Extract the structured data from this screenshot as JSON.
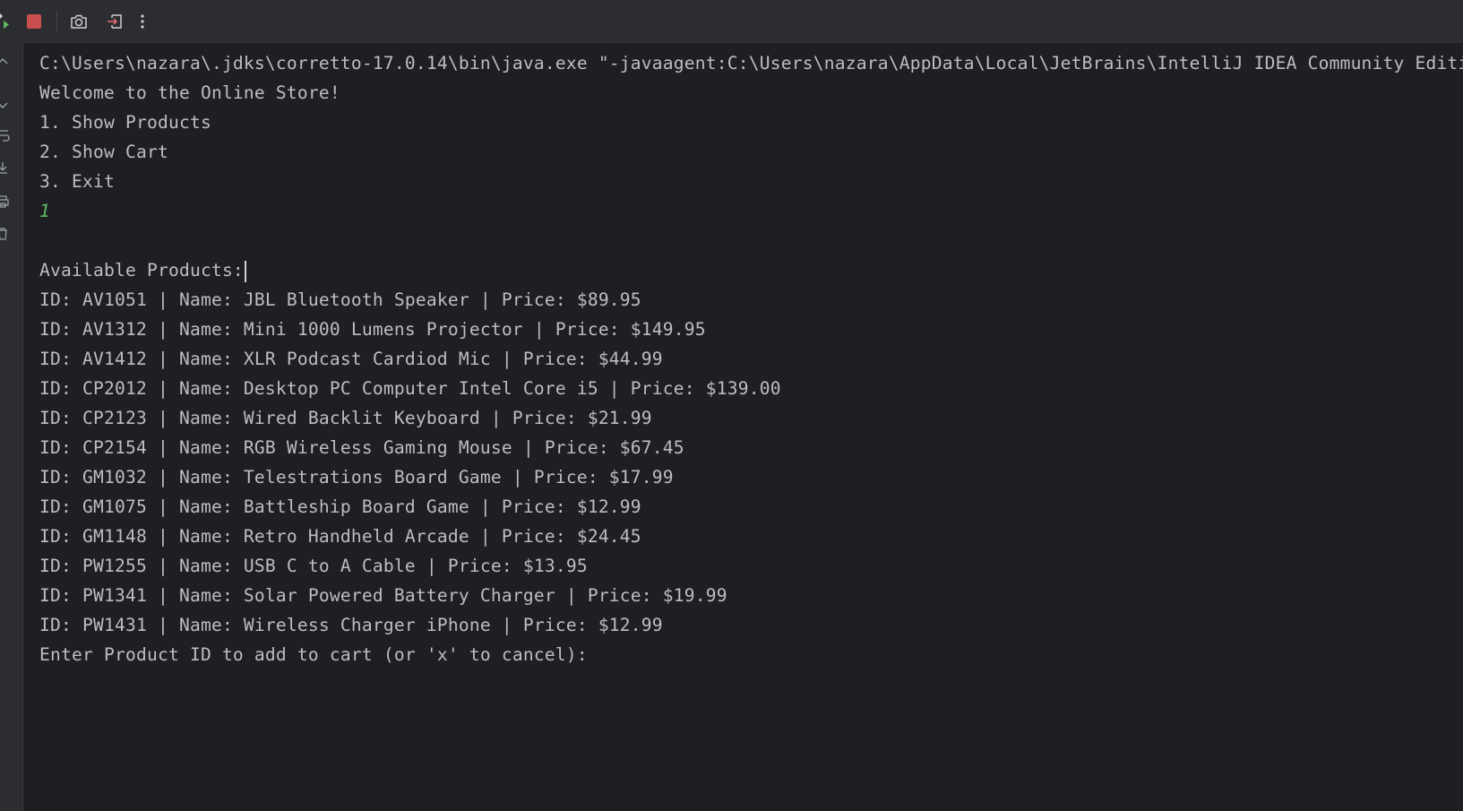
{
  "toolbar": {
    "rerun_icon": "rerun-icon",
    "stop_icon": "stop-icon",
    "camera_icon": "camera-icon",
    "exit_icon": "exit-icon",
    "more_icon": "more-vertical-icon"
  },
  "gutter": {
    "icons": [
      "chevron-up-icon",
      "chevron-down-icon",
      "soft-wrap-icon",
      "scroll-to-end-icon",
      "print-icon",
      "trash-icon"
    ]
  },
  "console": {
    "lines": [
      "C:\\Users\\nazara\\.jdks\\corretto-17.0.14\\bin\\java.exe \"-javaagent:C:\\Users\\nazara\\AppData\\Local\\JetBrains\\IntelliJ IDEA Community Editi",
      "Welcome to the Online Store!",
      "1. Show Products",
      "2. Show Cart",
      "3. Exit",
      "1",
      "",
      "Available Products:",
      "ID: AV1051 | Name: JBL Bluetooth Speaker | Price: $89.95",
      "ID: AV1312 | Name: Mini 1000 Lumens Projector | Price: $149.95",
      "ID: AV1412 | Name: XLR Podcast Cardiod Mic | Price: $44.99",
      "ID: CP2012 | Name: Desktop PC Computer Intel Core i5 | Price: $139.00",
      "ID: CP2123 | Name: Wired Backlit Keyboard | Price: $21.99",
      "ID: CP2154 | Name: RGB Wireless Gaming Mouse | Price: $67.45",
      "ID: GM1032 | Name: Telestrations Board Game | Price: $17.99",
      "ID: GM1075 | Name: Battleship Board Game | Price: $12.99",
      "ID: GM1148 | Name: Retro Handheld Arcade | Price: $24.45",
      "ID: PW1255 | Name: USB C to A Cable | Price: $13.95",
      "ID: PW1341 | Name: Solar Powered Battery Charger | Price: $19.99",
      "ID: PW1431 | Name: Wireless Charger iPhone | Price: $12.99",
      "Enter Product ID to add to cart (or 'x' to cancel):"
    ]
  },
  "colors": {
    "background": "#1e1f22",
    "toolbar": "#2b2d30",
    "text": "#bcbec4",
    "user_input": "#5fb865",
    "stop_red": "#c94f4f",
    "run_green": "#5fb865"
  }
}
